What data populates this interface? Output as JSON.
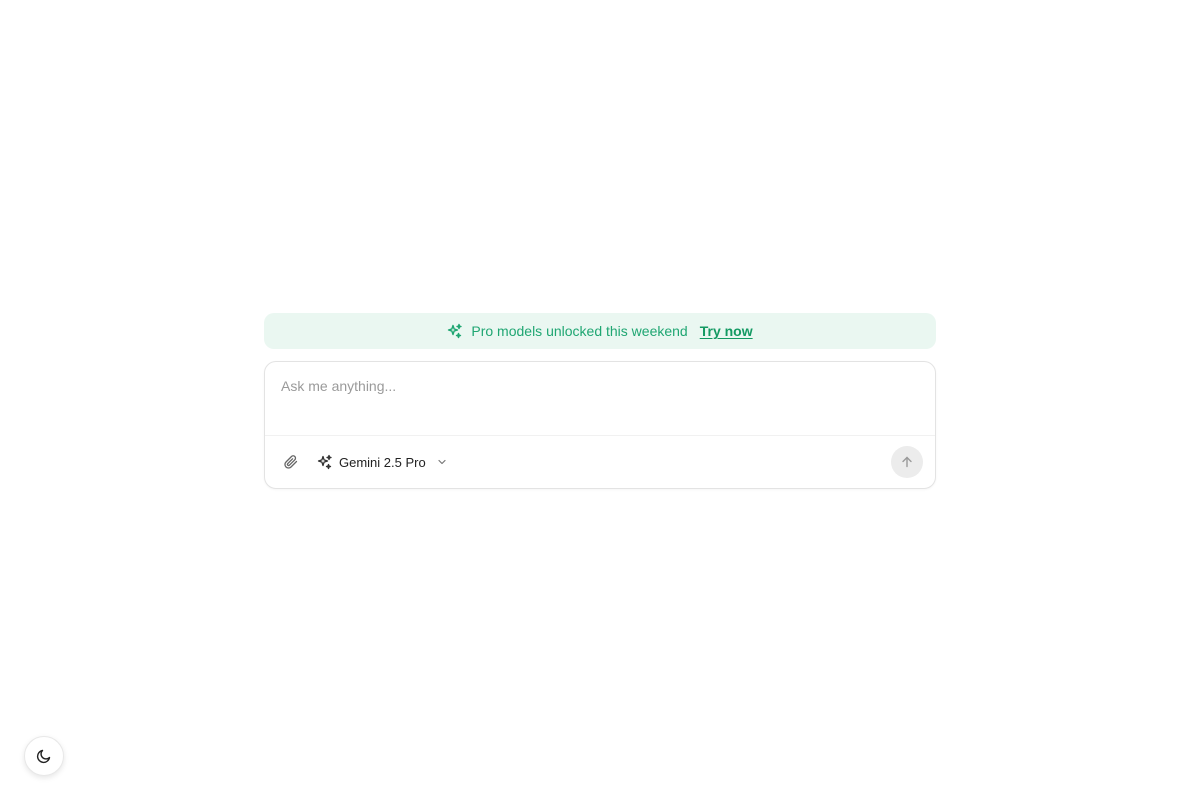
{
  "banner": {
    "message": "Pro models unlocked this weekend",
    "cta": "Try now",
    "icon": "sparkles-icon",
    "accent_color": "#1fa672",
    "background": "#eaf7f1"
  },
  "composer": {
    "placeholder": "Ask me anything...",
    "value": "",
    "attach_icon": "paperclip-icon",
    "model_icon": "sparkles-icon",
    "model_label": "Gemini 2.5 Pro",
    "model_dropdown_icon": "chevron-down-icon",
    "send_icon": "arrow-up-icon"
  },
  "theme_toggle": {
    "icon": "moon-icon"
  }
}
